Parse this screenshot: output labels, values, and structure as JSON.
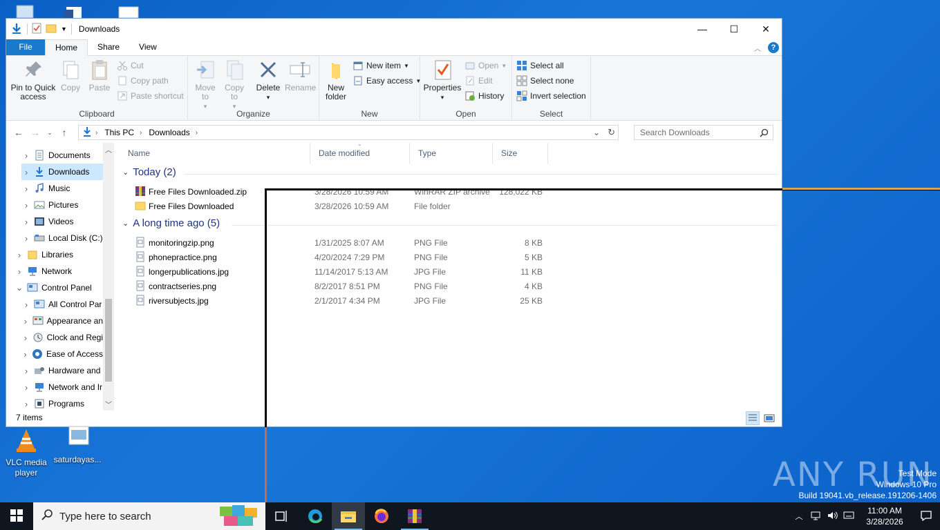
{
  "desktop": {
    "icons": [
      {
        "label": "VLC media player"
      },
      {
        "label": "saturdayas..."
      }
    ]
  },
  "window": {
    "title": "Downloads",
    "tabs": [
      "File",
      "Home",
      "Share",
      "View"
    ],
    "ribbon": {
      "clipboard": {
        "label": "Clipboard",
        "pin": "Pin to Quick access",
        "copy": "Copy",
        "paste": "Paste",
        "cut": "Cut",
        "copy_path": "Copy path",
        "paste_shortcut": "Paste shortcut"
      },
      "organize": {
        "label": "Organize",
        "move_to": "Move to",
        "copy_to": "Copy to",
        "delete": "Delete",
        "rename": "Rename"
      },
      "new": {
        "label": "New",
        "new_folder": "New folder",
        "new_item": "New item",
        "easy_access": "Easy access"
      },
      "open": {
        "label": "Open",
        "properties": "Properties",
        "open": "Open",
        "edit": "Edit",
        "history": "History"
      },
      "select": {
        "label": "Select",
        "select_all": "Select all",
        "select_none": "Select none",
        "invert": "Invert selection"
      }
    },
    "address": {
      "crumbs": [
        "This PC",
        "Downloads"
      ],
      "search_placeholder": "Search Downloads"
    },
    "nav": [
      {
        "label": "Documents"
      },
      {
        "label": "Downloads"
      },
      {
        "label": "Music"
      },
      {
        "label": "Pictures"
      },
      {
        "label": "Videos"
      },
      {
        "label": "Local Disk (C:)"
      },
      {
        "label": "Libraries"
      },
      {
        "label": "Network"
      },
      {
        "label": "Control Panel"
      },
      {
        "label": "All Control Par"
      },
      {
        "label": "Appearance an"
      },
      {
        "label": "Clock and Regi"
      },
      {
        "label": "Ease of Access"
      },
      {
        "label": "Hardware and"
      },
      {
        "label": "Network and Ir"
      },
      {
        "label": "Programs"
      }
    ],
    "columns": {
      "name": "Name",
      "date": "Date modified",
      "type": "Type",
      "size": "Size"
    },
    "groups": [
      {
        "title": "Today (2)",
        "files": [
          {
            "name": "Free Files Downloaded.zip",
            "date": "3/28/2026 10:59 AM",
            "type": "WinRAR ZIP archive",
            "size": "128,022 KB"
          },
          {
            "name": "Free Files Downloaded",
            "date": "3/28/2026 10:59 AM",
            "type": "File folder",
            "size": ""
          }
        ]
      },
      {
        "title": "A long time ago (5)",
        "files": [
          {
            "name": "monitoringzip.png",
            "date": "1/31/2025 8:07 AM",
            "type": "PNG File",
            "size": "8 KB"
          },
          {
            "name": "phonepractice.png",
            "date": "4/20/2024 7:29 PM",
            "type": "PNG File",
            "size": "5 KB"
          },
          {
            "name": "longerpublications.jpg",
            "date": "11/14/2017 5:13 AM",
            "type": "JPG File",
            "size": "11 KB"
          },
          {
            "name": "contractseries.png",
            "date": "8/2/2017 8:51 PM",
            "type": "PNG File",
            "size": "4 KB"
          },
          {
            "name": "riversubjects.jpg",
            "date": "2/1/2017 4:34 PM",
            "type": "JPG File",
            "size": "25 KB"
          }
        ]
      }
    ],
    "status": "7 items"
  },
  "taskbar": {
    "search_placeholder": "Type here to search",
    "time": "11:00 AM",
    "date": "3/28/2026"
  },
  "watermark": {
    "line1": "Test Mode",
    "line2": "Windows 10 Pro",
    "line3": "Build 19041.vb_release.191206-1406",
    "brand": "ANY RUN"
  }
}
